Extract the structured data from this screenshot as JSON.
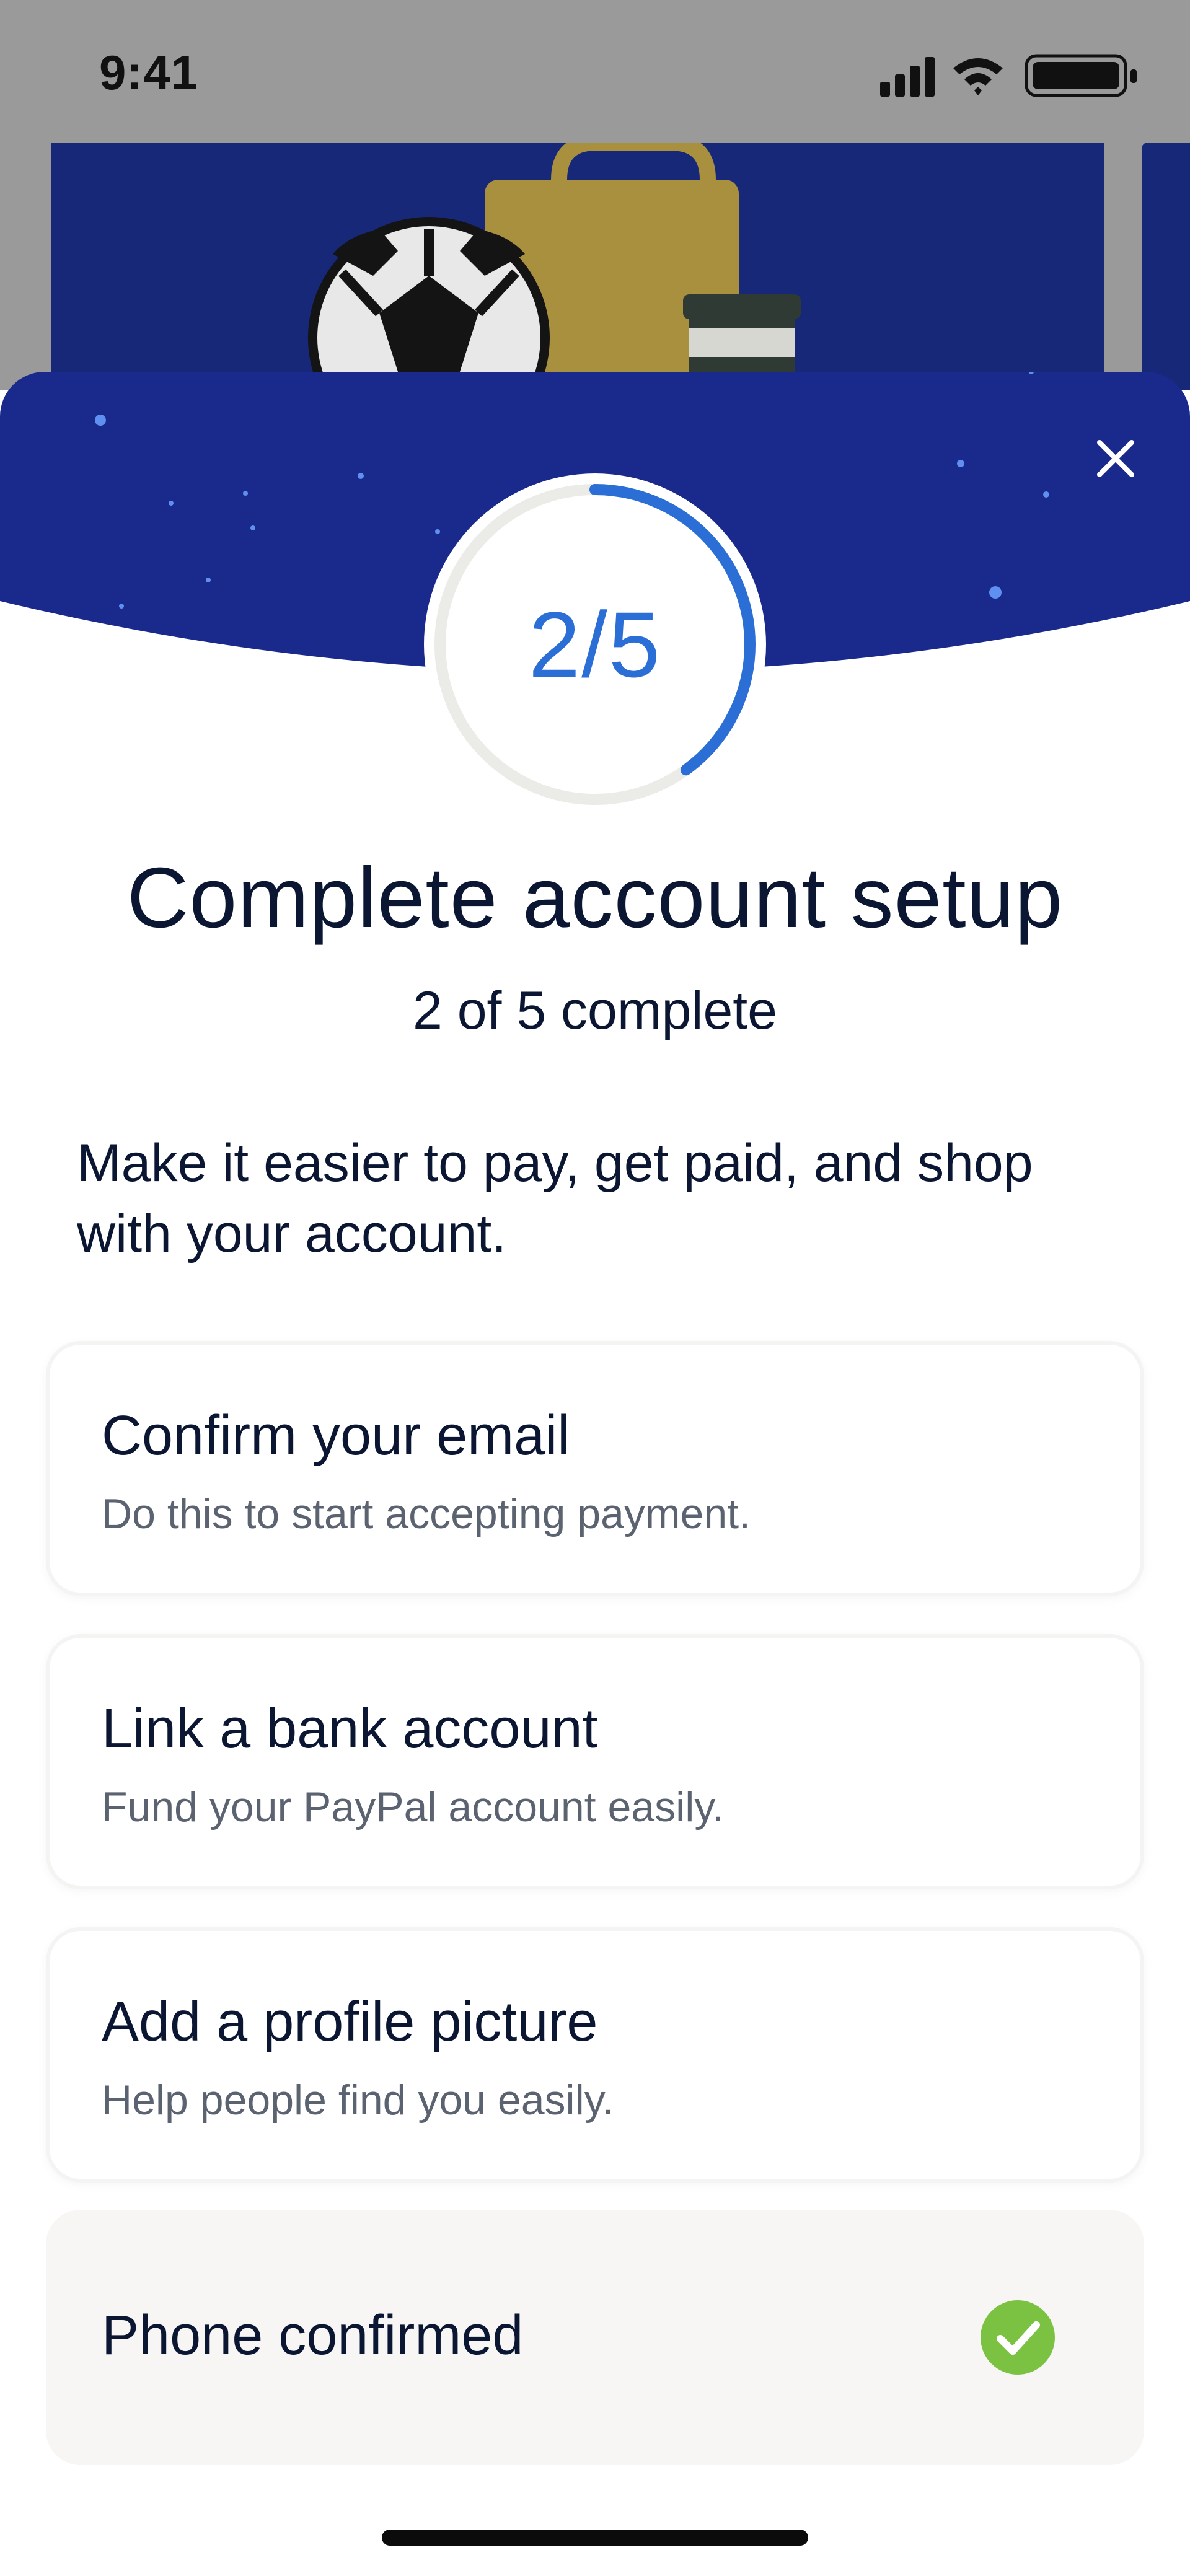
{
  "status_bar": {
    "time": "9:41",
    "icons": [
      "cellular-signal-icon",
      "wifi-icon",
      "battery-icon"
    ]
  },
  "header": {
    "close_icon": "close-icon",
    "progress": {
      "label": "2/5",
      "completed": 2,
      "total": 5,
      "fraction": 0.4
    }
  },
  "content": {
    "title": "Complete account setup",
    "subtitle": "2 of 5 complete",
    "description": "Make it easier to pay, get paid, and shop with your account."
  },
  "tasks": [
    {
      "title": "Confirm your email",
      "subtitle": "Do this to start accepting payment.",
      "done": false
    },
    {
      "title": "Link a bank account",
      "subtitle": "Fund your PayPal account easily.",
      "done": false
    },
    {
      "title": "Add a profile picture",
      "subtitle": "Help people find you easily.",
      "done": false
    },
    {
      "title": "Phone confirmed",
      "done": true,
      "status_icon": "check-circle-icon"
    }
  ],
  "colors": {
    "header_blue": "#1a2a8c",
    "banner_blue": "#172878",
    "progress_blue": "#2b6fd6",
    "text_dark": "#0b1633",
    "text_muted": "#5b6270",
    "success_green": "#7cc242"
  }
}
